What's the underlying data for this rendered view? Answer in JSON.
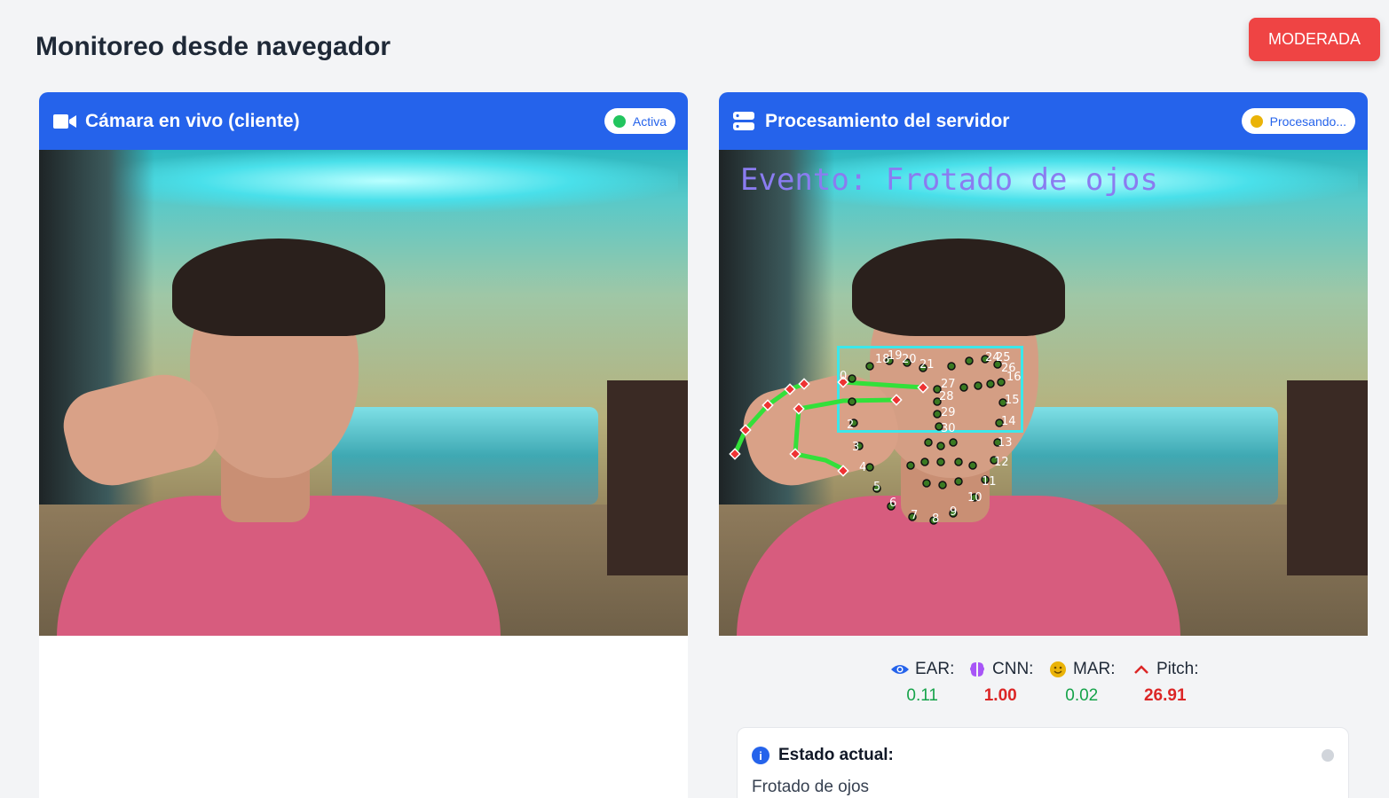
{
  "page": {
    "title": "Monitoreo desde navegador"
  },
  "alert_button": {
    "label": "MODERADA",
    "color": "#ef4444"
  },
  "camera_panel": {
    "title": "Cámara en vivo (cliente)",
    "icon": "video-camera-icon",
    "status": {
      "label": "Activa",
      "dot_color": "#22c55e"
    }
  },
  "server_panel": {
    "title": "Procesamiento del servidor",
    "icon": "server-icon",
    "status": {
      "label": "Procesando...",
      "dot_color": "#eab308"
    },
    "overlay_event_text": "Evento: Frotado de ojos",
    "metrics": [
      {
        "icon": "eye-icon",
        "label": "EAR:",
        "value": "0.11",
        "tone": "green"
      },
      {
        "icon": "brain-icon",
        "label": "CNN:",
        "value": "1.00",
        "tone": "red"
      },
      {
        "icon": "smile-icon",
        "label": "MAR:",
        "value": "0.02",
        "tone": "green"
      },
      {
        "icon": "chevron-up-icon",
        "label": "Pitch:",
        "value": "26.91",
        "tone": "red"
      }
    ],
    "state": {
      "title": "Estado actual:",
      "value": "Frotado de ojos"
    }
  },
  "colors": {
    "header_blue": "#2563eb",
    "value_green": "#16a34a",
    "value_red": "#dc2626"
  }
}
